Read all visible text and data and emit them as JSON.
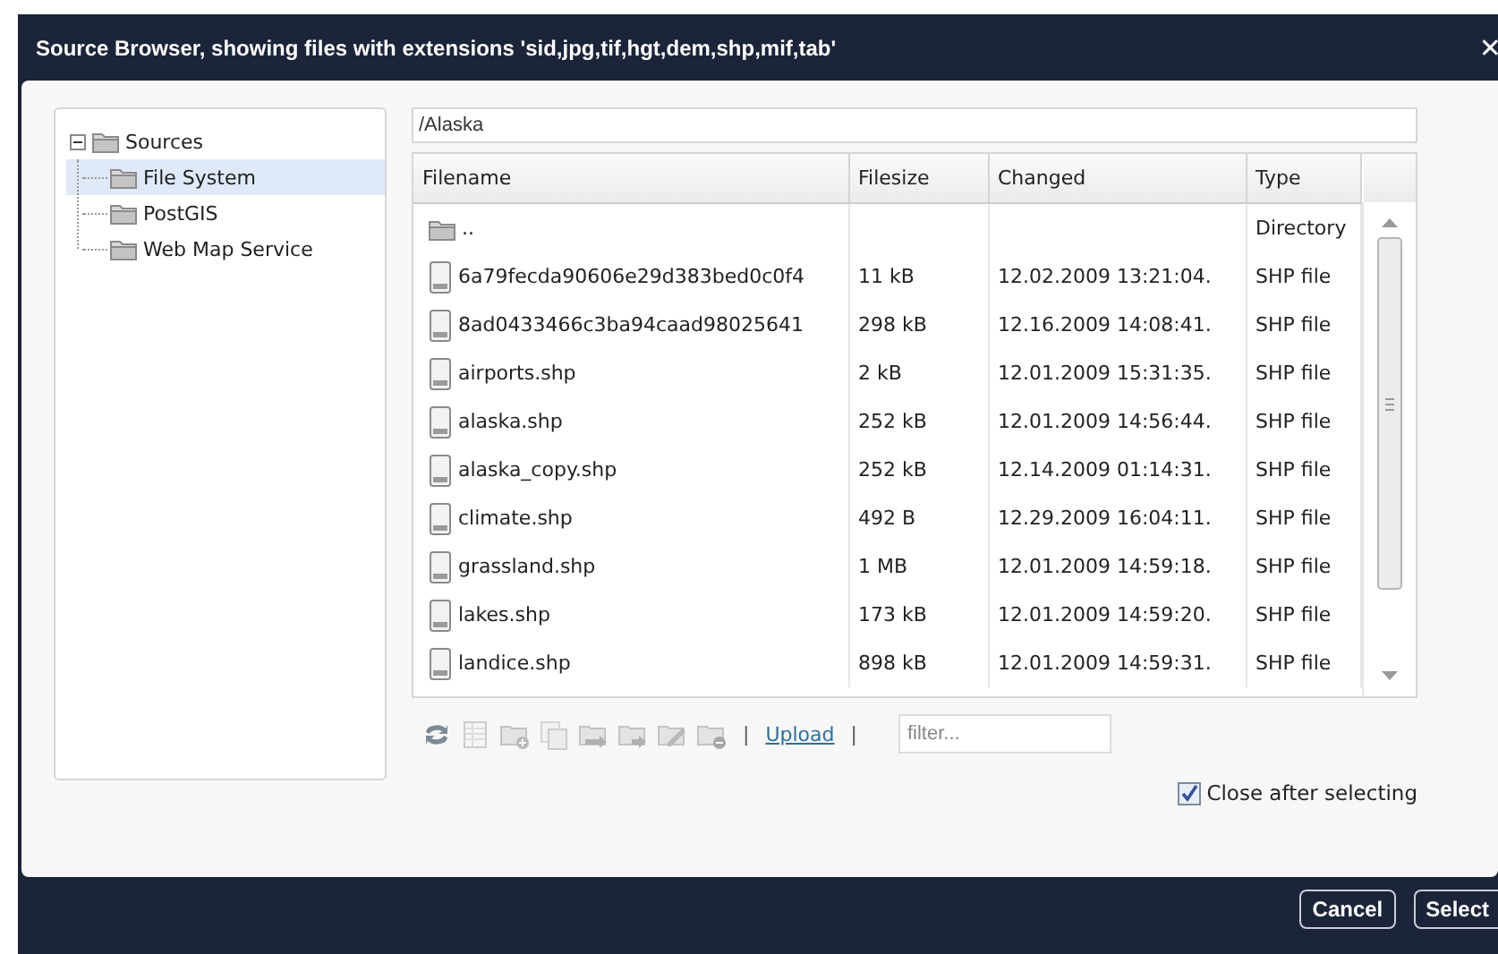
{
  "window": {
    "title": "Source Browser, showing files with extensions 'sid,jpg,tif,hgt,dem,shp,mif,tab'",
    "close": "✕"
  },
  "tree": [
    {
      "label": "Sources",
      "expanded": true,
      "selected": false,
      "children": [
        {
          "label": "File System",
          "selected": true
        },
        {
          "label": "PostGIS",
          "selected": false
        },
        {
          "label": "Web Map Service",
          "selected": false
        }
      ]
    }
  ],
  "path": {
    "value": "/Alaska"
  },
  "table": {
    "columns": [
      "Filename",
      "Filesize",
      "Changed",
      "Type"
    ],
    "rows": [
      {
        "kind": "folder",
        "cells": [
          "..",
          "",
          "",
          "Directory"
        ]
      },
      {
        "kind": "file",
        "cells": [
          "6a79fecda90606e29d383bed0c0f4",
          "11 kB",
          "12.02.2009 13:21:04.",
          "SHP file"
        ]
      },
      {
        "kind": "file",
        "cells": [
          "8ad0433466c3ba94caad98025641",
          "298 kB",
          "12.16.2009 14:08:41.",
          "SHP file"
        ]
      },
      {
        "kind": "file",
        "cells": [
          "airports.shp",
          "2 kB",
          "12.01.2009 15:31:35.",
          "SHP file"
        ]
      },
      {
        "kind": "file",
        "cells": [
          "alaska.shp",
          "252 kB",
          "12.01.2009 14:56:44.",
          "SHP file"
        ]
      },
      {
        "kind": "file",
        "cells": [
          "alaska_copy.shp",
          "252 kB",
          "12.14.2009 01:14:31.",
          "SHP file"
        ]
      },
      {
        "kind": "file",
        "cells": [
          "climate.shp",
          "492 B",
          "12.29.2009 16:04:11.",
          "SHP file"
        ]
      },
      {
        "kind": "file",
        "cells": [
          "grassland.shp",
          "1 MB",
          "12.01.2009 14:59:18.",
          "SHP file"
        ]
      },
      {
        "kind": "file",
        "cells": [
          "lakes.shp",
          "173 kB",
          "12.01.2009 14:59:20.",
          "SHP file"
        ]
      },
      {
        "kind": "file",
        "cells": [
          "landice.shp",
          "898 kB",
          "12.01.2009 14:59:31.",
          "SHP file"
        ]
      }
    ]
  },
  "toolbar": {
    "tools": [
      {
        "kind": "refresh",
        "disabled": false
      },
      {
        "kind": "table",
        "disabled": true
      },
      {
        "kind": "folder-add",
        "disabled": true
      },
      {
        "kind": "copy",
        "disabled": true
      },
      {
        "kind": "folder-move",
        "disabled": true
      },
      {
        "kind": "folder-arrow",
        "disabled": true
      },
      {
        "kind": "folder-edit",
        "disabled": true
      },
      {
        "kind": "folder-remove",
        "disabled": true
      }
    ],
    "separator": "|",
    "link": "Upload",
    "separator_2": "|",
    "filter": {
      "placeholder": "filter..."
    }
  },
  "close_after_selecting": {
    "label": "Close after selecting",
    "checked": true
  },
  "buttons": [
    "Cancel",
    "Select"
  ]
}
